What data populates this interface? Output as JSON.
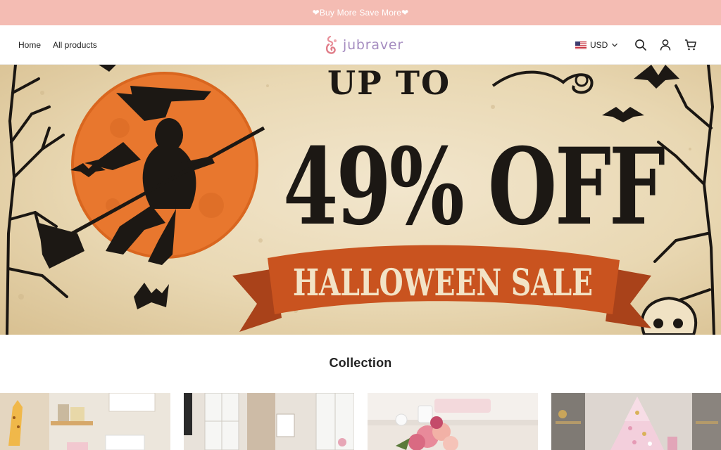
{
  "announcement": {
    "text": "❤Buy More Save More❤"
  },
  "header": {
    "nav": [
      {
        "label": "Home"
      },
      {
        "label": "All products"
      }
    ],
    "logo_text": "jubraver",
    "currency": "USD"
  },
  "hero": {
    "line1": "UP TO",
    "line2": "49% OFF",
    "ribbon": "HALLOWEEN SALE"
  },
  "collection": {
    "title": "Collection",
    "cards": [
      {
        "name": "nursery-room"
      },
      {
        "name": "window-room"
      },
      {
        "name": "pink-flowers"
      },
      {
        "name": "pink-christmas-tree"
      }
    ]
  },
  "colors": {
    "announcement_bg": "#f4bcb3",
    "logo": "#a58cc0",
    "moon": "#e8772e",
    "ribbon": "#c9531f"
  }
}
